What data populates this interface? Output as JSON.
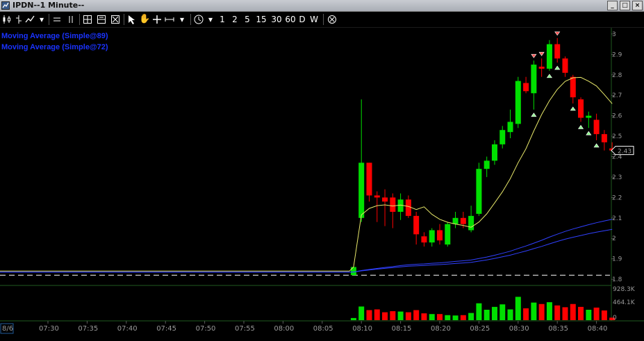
{
  "window": {
    "title": "IPDN--1 Minute--",
    "buttons": [
      "_",
      "□",
      "×"
    ]
  },
  "toolbar": {
    "periods": [
      "1",
      "2",
      "5",
      "15",
      "30",
      "60",
      "D",
      "W"
    ]
  },
  "legend": [
    {
      "label": "Moving Average (Simple@89)",
      "color": "#1a33ff"
    },
    {
      "label": "Moving Average (Simple@72)",
      "color": "#1a33ff"
    }
  ],
  "colors": {
    "up": "#00e000",
    "down": "#ff0000",
    "ma_fast": "#e8e86a",
    "ma_slow": "#3040ff",
    "grid": "#1f5a1f",
    "background": "#000000"
  },
  "chart_data": {
    "type": "candlestick",
    "symbol": "IPDN",
    "interval": "1 Minute",
    "price_axis": {
      "ticks": [
        "3",
        "2.9",
        "2.8",
        "2.7",
        "2.6",
        "2.5",
        "2.4",
        "2.3",
        "2.2",
        "2.1",
        "2",
        "1.9",
        "1.8"
      ],
      "ylim": [
        1.78,
        3.02
      ]
    },
    "last_price_label": "2.43",
    "volume_axis": {
      "ticks": [
        "928.3K",
        "464.1K",
        "0"
      ],
      "ylim": [
        0,
        928300
      ]
    },
    "time_axis": {
      "labels": [
        "8/6",
        "07:30",
        "07:35",
        "07:40",
        "07:45",
        "07:50",
        "07:55",
        "08:00",
        "08:05",
        "08:10",
        "08:15",
        "08:20",
        "08:25",
        "08:30",
        "08:35",
        "08:40"
      ]
    },
    "candles": [
      {
        "time": "08:09",
        "open": 1.82,
        "high": 1.86,
        "low": 1.82,
        "close": 1.86,
        "volume": 60000
      },
      {
        "time": "08:10",
        "open": 2.1,
        "high": 2.68,
        "low": 2.08,
        "close": 2.37,
        "volume": 380000
      },
      {
        "time": "08:11",
        "open": 2.37,
        "high": 2.37,
        "low": 2.18,
        "close": 2.21,
        "volume": 280000
      },
      {
        "time": "08:12",
        "open": 2.21,
        "high": 2.23,
        "low": 2.08,
        "close": 2.2,
        "volume": 300000
      },
      {
        "time": "08:13",
        "open": 2.2,
        "high": 2.24,
        "low": 2.06,
        "close": 2.18,
        "volume": 220000
      },
      {
        "time": "08:14",
        "open": 2.2,
        "high": 2.22,
        "low": 2.05,
        "close": 2.13,
        "volume": 250000
      },
      {
        "time": "08:15",
        "open": 2.13,
        "high": 2.22,
        "low": 2.09,
        "close": 2.19,
        "volume": 240000
      },
      {
        "time": "08:16",
        "open": 2.19,
        "high": 2.21,
        "low": 2.1,
        "close": 2.11,
        "volume": 220000
      },
      {
        "time": "08:17",
        "open": 2.11,
        "high": 2.13,
        "low": 1.97,
        "close": 2.02,
        "volume": 280000
      },
      {
        "time": "08:18",
        "open": 2.01,
        "high": 2.03,
        "low": 1.96,
        "close": 1.98,
        "volume": 190000
      },
      {
        "time": "08:19",
        "open": 1.98,
        "high": 2.05,
        "low": 1.96,
        "close": 2.04,
        "volume": 170000
      },
      {
        "time": "08:20",
        "open": 2.04,
        "high": 2.07,
        "low": 1.97,
        "close": 1.99,
        "volume": 170000
      },
      {
        "time": "08:21",
        "open": 1.97,
        "high": 2.08,
        "low": 1.96,
        "close": 2.07,
        "volume": 140000
      },
      {
        "time": "08:22",
        "open": 2.07,
        "high": 2.13,
        "low": 2.05,
        "close": 2.1,
        "volume": 130000
      },
      {
        "time": "08:23",
        "open": 2.1,
        "high": 2.13,
        "low": 2.05,
        "close": 2.07,
        "volume": 140000
      },
      {
        "time": "08:24",
        "open": 2.04,
        "high": 2.16,
        "low": 2.03,
        "close": 2.11,
        "volume": 200000
      },
      {
        "time": "08:25",
        "open": 2.12,
        "high": 2.37,
        "low": 2.11,
        "close": 2.34,
        "volume": 470000
      },
      {
        "time": "08:26",
        "open": 2.34,
        "high": 2.4,
        "low": 2.3,
        "close": 2.38,
        "volume": 290000
      },
      {
        "time": "08:27",
        "open": 2.38,
        "high": 2.48,
        "low": 2.36,
        "close": 2.46,
        "volume": 370000
      },
      {
        "time": "08:28",
        "open": 2.46,
        "high": 2.55,
        "low": 2.44,
        "close": 2.53,
        "volume": 440000
      },
      {
        "time": "08:29",
        "open": 2.52,
        "high": 2.63,
        "low": 2.49,
        "close": 2.57,
        "volume": 300000
      },
      {
        "time": "08:30",
        "open": 2.56,
        "high": 2.79,
        "low": 2.54,
        "close": 2.77,
        "volume": 650000
      },
      {
        "time": "08:31",
        "open": 2.76,
        "high": 2.79,
        "low": 2.71,
        "close": 2.72,
        "volume": 330000
      },
      {
        "time": "08:32",
        "open": 2.71,
        "high": 2.87,
        "low": 2.63,
        "close": 2.85,
        "volume": 490000
      },
      {
        "time": "08:33",
        "open": 2.84,
        "high": 2.88,
        "low": 2.79,
        "close": 2.83,
        "volume": 450000
      },
      {
        "time": "08:34",
        "open": 2.83,
        "high": 2.97,
        "low": 2.82,
        "close": 2.95,
        "volume": 500000
      },
      {
        "time": "08:35",
        "open": 2.95,
        "high": 2.98,
        "low": 2.86,
        "close": 2.88,
        "volume": 410000
      },
      {
        "time": "08:36",
        "open": 2.88,
        "high": 2.89,
        "low": 2.79,
        "close": 2.81,
        "volume": 360000
      },
      {
        "time": "08:37",
        "open": 2.79,
        "high": 2.8,
        "low": 2.66,
        "close": 2.69,
        "volume": 450000
      },
      {
        "time": "08:38",
        "open": 2.68,
        "high": 2.69,
        "low": 2.57,
        "close": 2.59,
        "volume": 370000
      },
      {
        "time": "08:39",
        "open": 2.59,
        "high": 2.62,
        "low": 2.54,
        "close": 2.6,
        "volume": 290000
      },
      {
        "time": "08:40",
        "open": 2.58,
        "high": 2.61,
        "low": 2.48,
        "close": 2.51,
        "volume": 350000
      },
      {
        "time": "08:41",
        "open": 2.51,
        "high": 2.53,
        "low": 2.43,
        "close": 2.47,
        "volume": 270000
      },
      {
        "time": "08:42",
        "open": 2.44,
        "high": 2.47,
        "low": 2.43,
        "close": 2.43,
        "volume": 70000
      }
    ]
  }
}
